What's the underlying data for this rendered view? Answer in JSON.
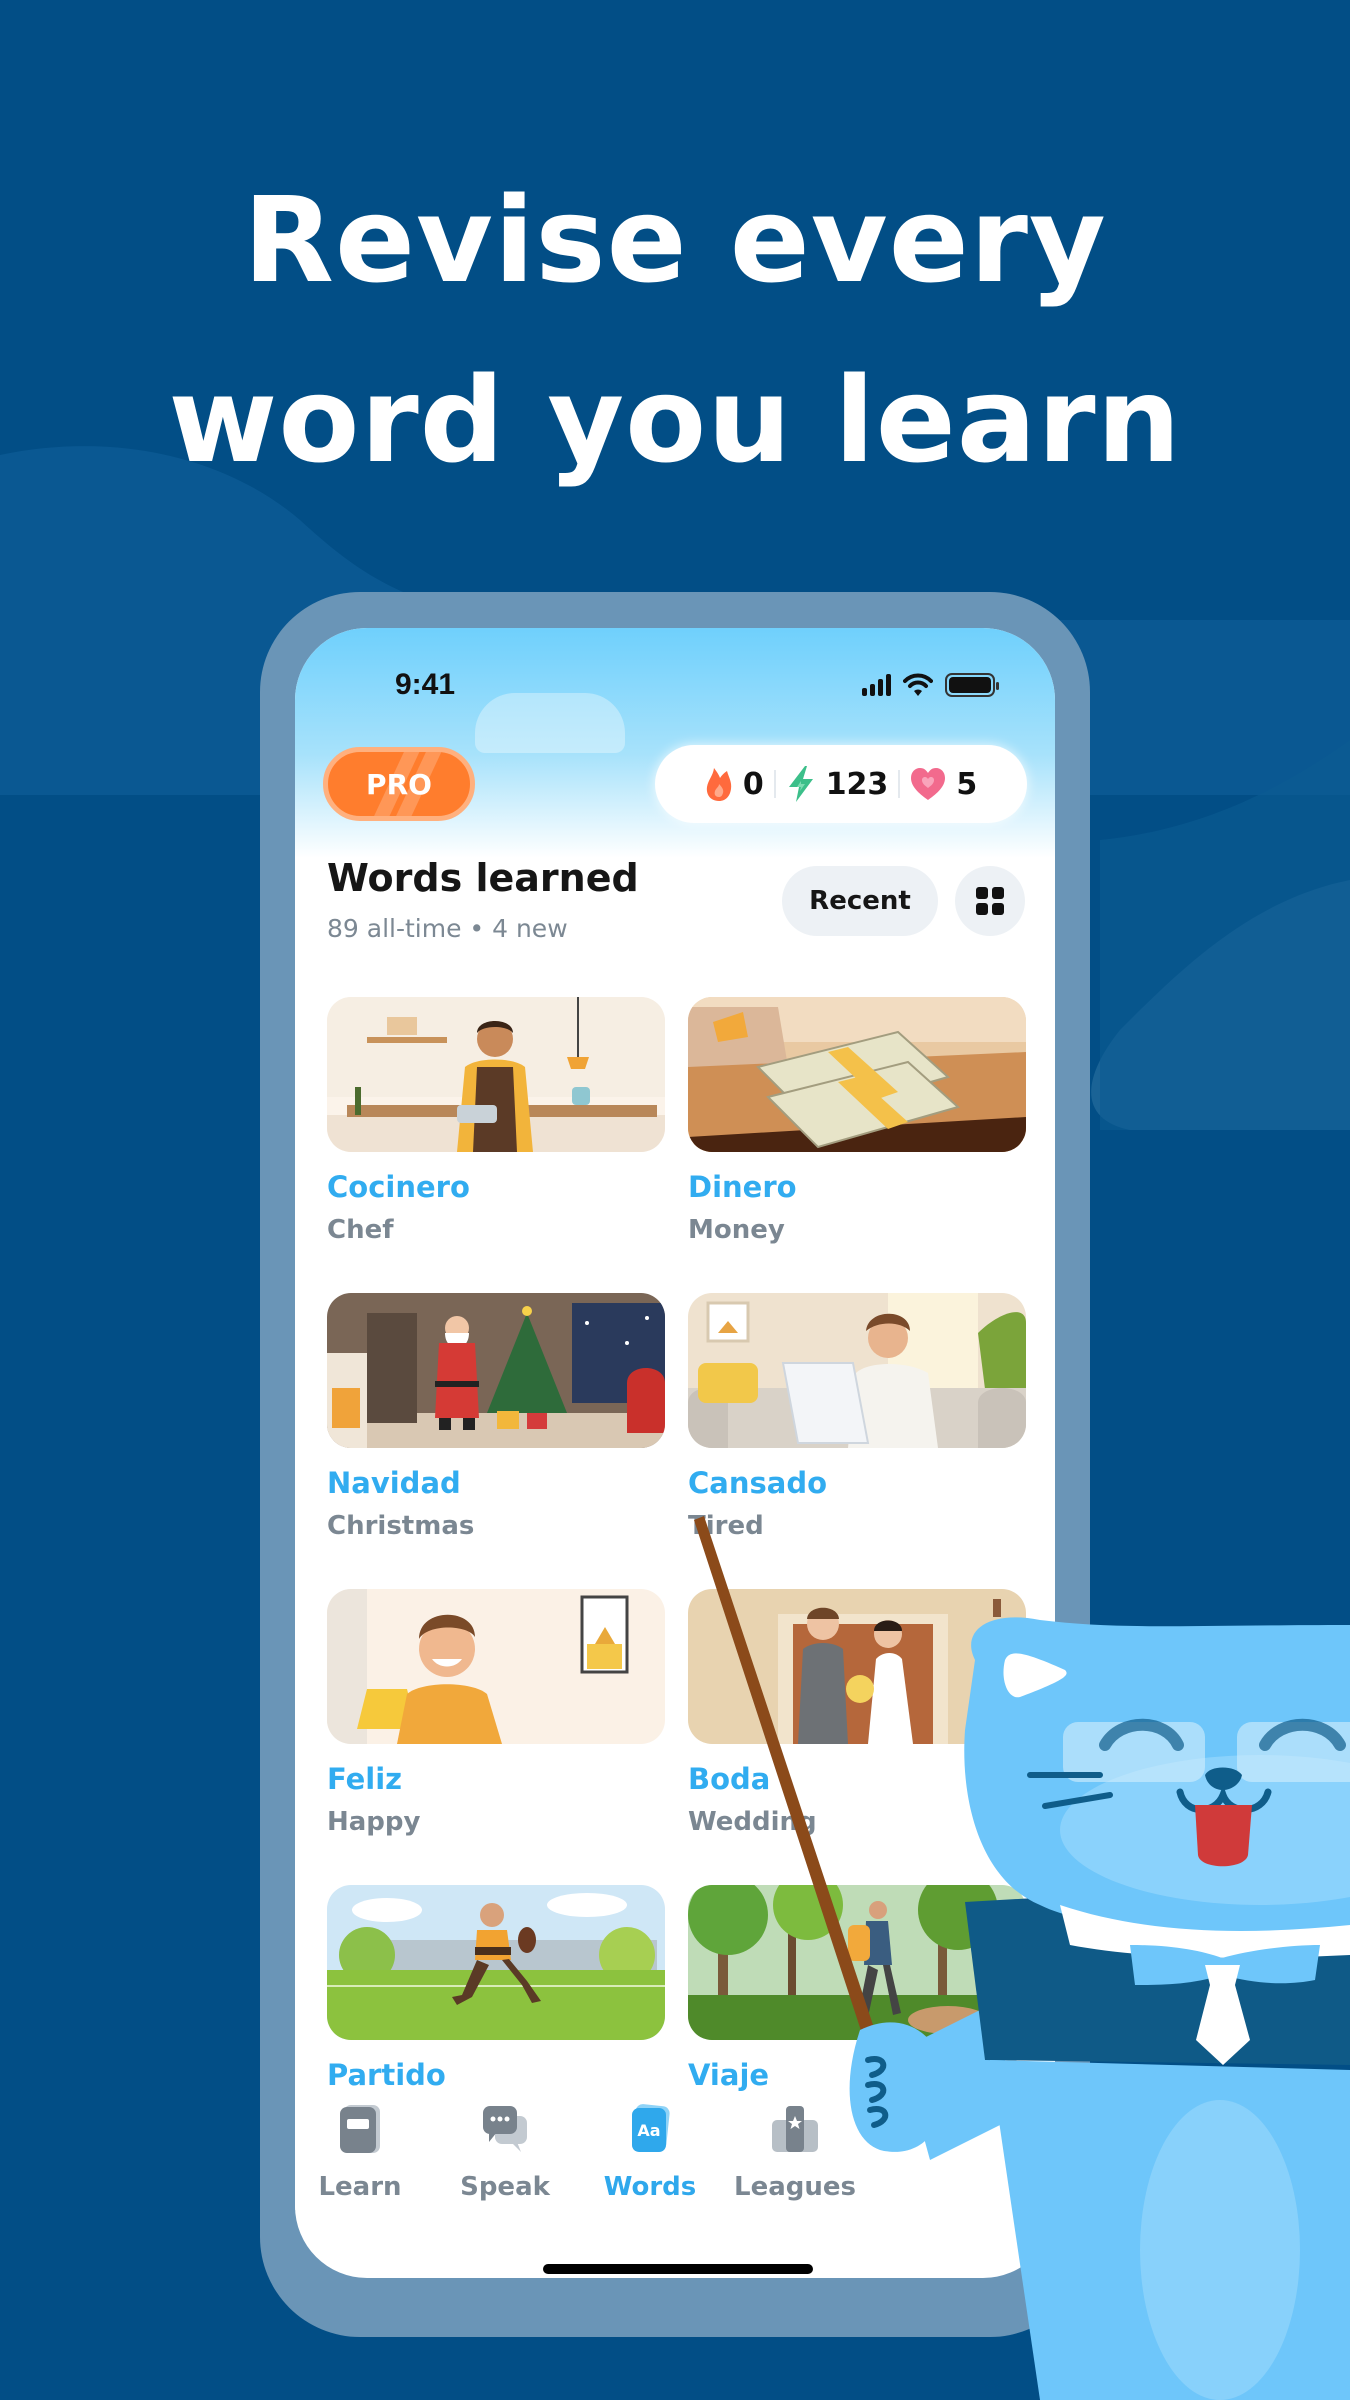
{
  "headline": {
    "line1": "Revise every",
    "line2": "word you learn"
  },
  "colors": {
    "background": "#024e86",
    "accent_blue": "#31acf0",
    "pro_orange": "#ff7d2d",
    "streak": "#ff6a3d",
    "energy": "#3cbf8a",
    "hearts": "#f26a8d"
  },
  "status_bar": {
    "time": "9:41",
    "icons": [
      "cellular-signal-icon",
      "wifi-icon",
      "battery-icon"
    ]
  },
  "header": {
    "pro_label": "PRO",
    "stats": [
      {
        "icon": "flame-icon",
        "value": "0"
      },
      {
        "icon": "lightning-icon",
        "value": "123"
      },
      {
        "icon": "heart-icon",
        "value": "5"
      }
    ]
  },
  "section": {
    "title": "Words learned",
    "subtitle": "89 all-time • 4 new",
    "sort_label": "Recent",
    "view_toggle_icon": "grid-view-icon"
  },
  "words": [
    {
      "word": "Cocinero",
      "translation": "Chef",
      "image": "chef-cooking-illustration"
    },
    {
      "word": "Dinero",
      "translation": "Money",
      "image": "money-stacks-illustration"
    },
    {
      "word": "Navidad",
      "translation": "Christmas",
      "image": "santa-christmas-illustration"
    },
    {
      "word": "Cansado",
      "translation": "Tired",
      "image": "tired-man-laptop-illustration"
    },
    {
      "word": "Feliz",
      "translation": "Happy",
      "image": "happy-man-illustration"
    },
    {
      "word": "Boda",
      "translation": "Wedding",
      "image": "wedding-couple-illustration"
    },
    {
      "word": "Partido",
      "translation": "",
      "image": "football-match-illustration"
    },
    {
      "word": "Viaje",
      "translation": "",
      "image": "forest-hiker-illustration"
    }
  ],
  "nav": {
    "active": "Words",
    "items": [
      {
        "label": "Learn",
        "icon": "book-icon"
      },
      {
        "label": "Speak",
        "icon": "chat-bubbles-icon"
      },
      {
        "label": "Words",
        "icon": "vocabulary-aa-icon"
      },
      {
        "label": "Leagues",
        "icon": "podium-icon"
      }
    ]
  },
  "mascot": "blue-cat-teacher-with-pointer"
}
